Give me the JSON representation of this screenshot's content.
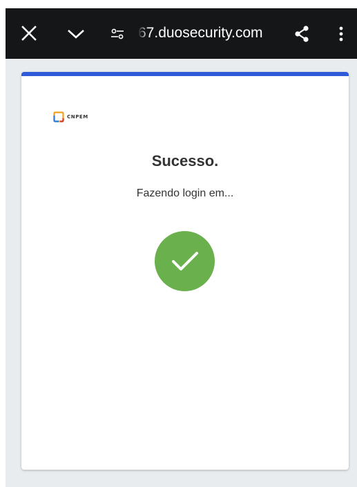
{
  "browser": {
    "url": "67.duosecurity.com",
    "bar_color": "#151618",
    "icons": {
      "close": "close-icon",
      "minimize": "chevron-down-icon",
      "site_settings": "tune-icon",
      "share": "share-icon",
      "menu": "more-vert-icon"
    }
  },
  "card": {
    "accent_color": "#2e59d9",
    "logo_text": "CNPEM",
    "title": "Sucesso.",
    "subtitle": "Fazendo login em...",
    "status_icon": "checkmark-icon",
    "success_color": "#6ab04c"
  }
}
